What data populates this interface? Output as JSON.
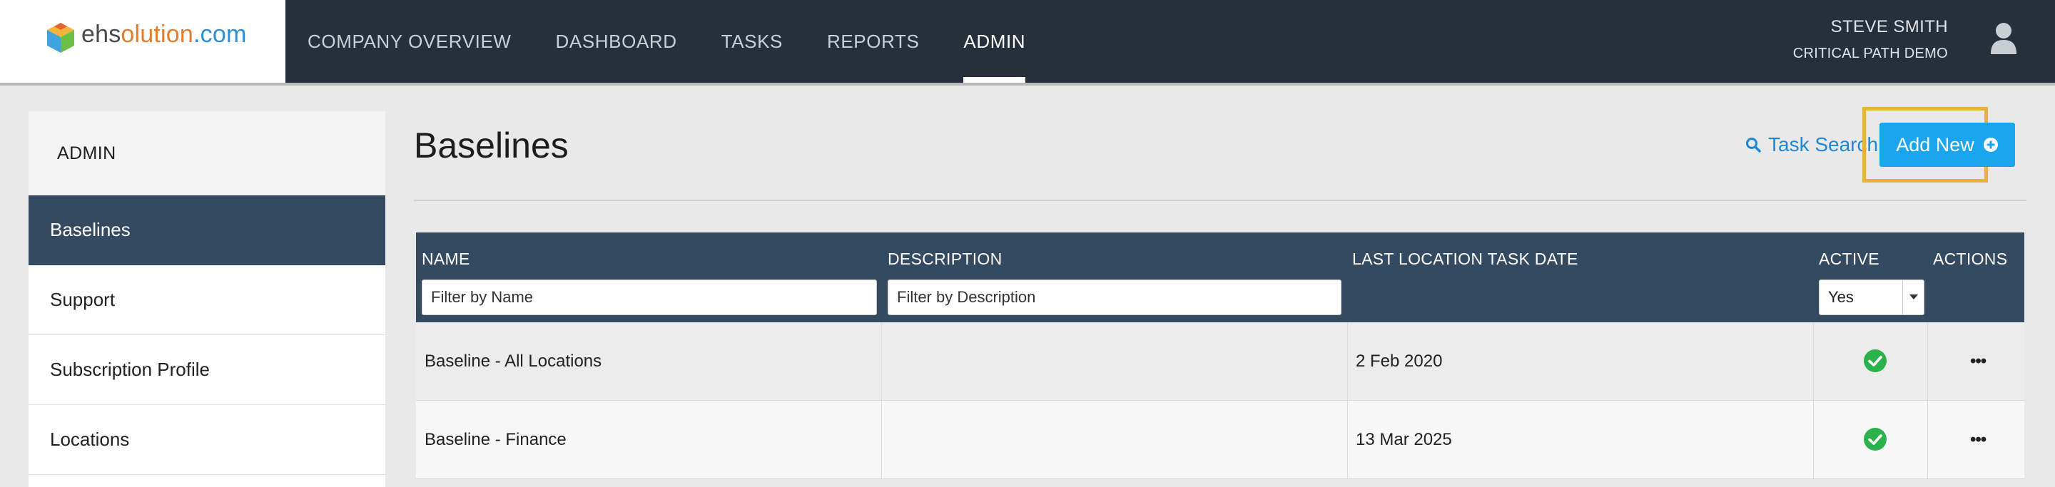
{
  "app": {
    "logo_text_prefix": "ehs",
    "logo_text_mid": "olution",
    "logo_text_suffix": ".com"
  },
  "nav": {
    "items": [
      {
        "label": "COMPANY OVERVIEW",
        "active": false
      },
      {
        "label": "DASHBOARD",
        "active": false
      },
      {
        "label": "TASKS",
        "active": false
      },
      {
        "label": "REPORTS",
        "active": false
      },
      {
        "label": "ADMIN",
        "active": true
      }
    ]
  },
  "user": {
    "name": "STEVE SMITH",
    "org": "CRITICAL PATH DEMO",
    "icon": "user-avatar-icon"
  },
  "sidebar": {
    "heading": "ADMIN",
    "items": [
      {
        "label": "Baselines",
        "active": true
      },
      {
        "label": "Support",
        "active": false
      },
      {
        "label": "Subscription Profile",
        "active": false
      },
      {
        "label": "Locations",
        "active": false
      }
    ]
  },
  "main": {
    "title": "Baselines",
    "task_search_label": "Task Search",
    "add_new_label": "Add New"
  },
  "table": {
    "columns": {
      "name": "NAME",
      "description": "DESCRIPTION",
      "last_date": "LAST LOCATION TASK DATE",
      "active": "ACTIVE",
      "actions": "ACTIONS"
    },
    "filters": {
      "name_placeholder": "Filter by Name",
      "description_placeholder": "Filter by Description",
      "active_value": "Yes"
    },
    "rows": [
      {
        "name": "Baseline - All Locations",
        "description": "",
        "last_date": "2 Feb 2020",
        "active": true
      },
      {
        "name": "Baseline - Finance",
        "description": "",
        "last_date": "13 Mar 2025",
        "active": true
      }
    ]
  },
  "colors": {
    "topbar": "#27303a",
    "sidebar_active": "#344a60",
    "accent_blue": "#1ba5ee",
    "highlight_outline": "#e9b23c",
    "check_green": "#2bb24c"
  }
}
